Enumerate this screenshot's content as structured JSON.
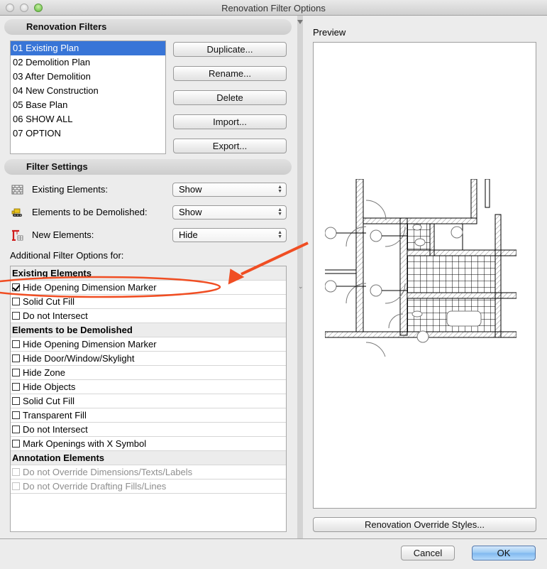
{
  "window": {
    "title": "Renovation Filter Options"
  },
  "renovation_filters": {
    "heading": "Renovation Filters",
    "items": [
      {
        "label": "01 Existing Plan",
        "selected": true
      },
      {
        "label": "02 Demolition Plan",
        "selected": false
      },
      {
        "label": "03 After Demolition",
        "selected": false
      },
      {
        "label": "04 New Construction",
        "selected": false
      },
      {
        "label": "05 Base Plan",
        "selected": false
      },
      {
        "label": "06 SHOW ALL",
        "selected": false
      },
      {
        "label": "07 OPTION",
        "selected": false
      }
    ],
    "buttons": {
      "duplicate": "Duplicate...",
      "rename": "Rename...",
      "delete": "Delete",
      "import": "Import...",
      "export": "Export..."
    }
  },
  "filter_settings": {
    "heading": "Filter Settings",
    "rows": [
      {
        "label": "Existing Elements:",
        "icon": "brick-wall-icon",
        "value": "Show"
      },
      {
        "label": "Elements to be Demolished:",
        "icon": "bulldozer-icon",
        "value": "Show"
      },
      {
        "label": "New Elements:",
        "icon": "crane-icon",
        "value": "Hide"
      }
    ],
    "additional_label": "Additional Filter Options for:"
  },
  "options": {
    "groups": [
      {
        "heading": "Existing Elements",
        "items": [
          {
            "label": "Hide Opening Dimension Marker",
            "checked": true,
            "disabled": false
          },
          {
            "label": "Solid Cut Fill",
            "checked": false,
            "disabled": false
          },
          {
            "label": "Do not Intersect",
            "checked": false,
            "disabled": false
          }
        ]
      },
      {
        "heading": "Elements to be Demolished",
        "items": [
          {
            "label": "Hide Opening Dimension Marker",
            "checked": false,
            "disabled": false
          },
          {
            "label": "Hide Door/Window/Skylight",
            "checked": false,
            "disabled": false
          },
          {
            "label": "Hide Zone",
            "checked": false,
            "disabled": false
          },
          {
            "label": "Hide Objects",
            "checked": false,
            "disabled": false
          },
          {
            "label": "Solid Cut Fill",
            "checked": false,
            "disabled": false
          },
          {
            "label": "Transparent Fill",
            "checked": false,
            "disabled": false
          },
          {
            "label": "Do not Intersect",
            "checked": false,
            "disabled": false
          },
          {
            "label": "Mark Openings with X Symbol",
            "checked": false,
            "disabled": false
          }
        ]
      },
      {
        "heading": "Annotation Elements",
        "items": [
          {
            "label": "Do not Override Dimensions/Texts/Labels",
            "checked": false,
            "disabled": true
          },
          {
            "label": "Do not Override Drafting Fills/Lines",
            "checked": false,
            "disabled": true
          }
        ]
      }
    ]
  },
  "preview": {
    "label": "Preview",
    "override_button": "Renovation Override Styles..."
  },
  "footer": {
    "cancel": "Cancel",
    "ok": "OK"
  },
  "colors": {
    "selection": "#3875d7",
    "annotation": "#f04e23",
    "ok_button": "#8fc3f2"
  }
}
